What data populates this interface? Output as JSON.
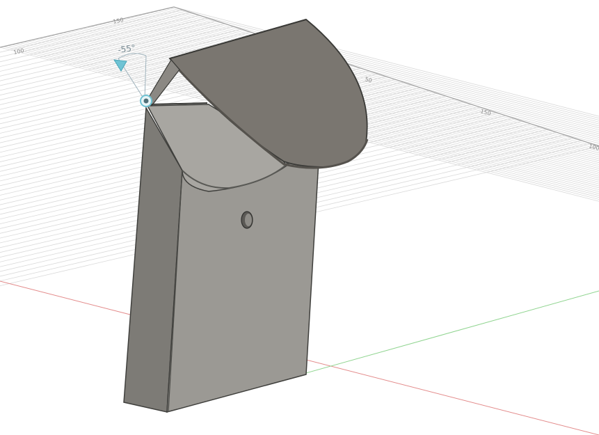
{
  "viewport": {
    "background": "#ffffff",
    "grid_color": "#d9d9d9",
    "axis_x_color": "#e38a8a",
    "axis_y_color": "#8fd48f"
  },
  "ruler_labels": [
    "150",
    "100",
    "50",
    "150",
    "100"
  ],
  "manipulator": {
    "angle_label": "-55°",
    "color": "#6fc3d4"
  },
  "model": {
    "body_color": "#8f8d87",
    "lid_color": "#7e7a72",
    "hole_present": true
  }
}
